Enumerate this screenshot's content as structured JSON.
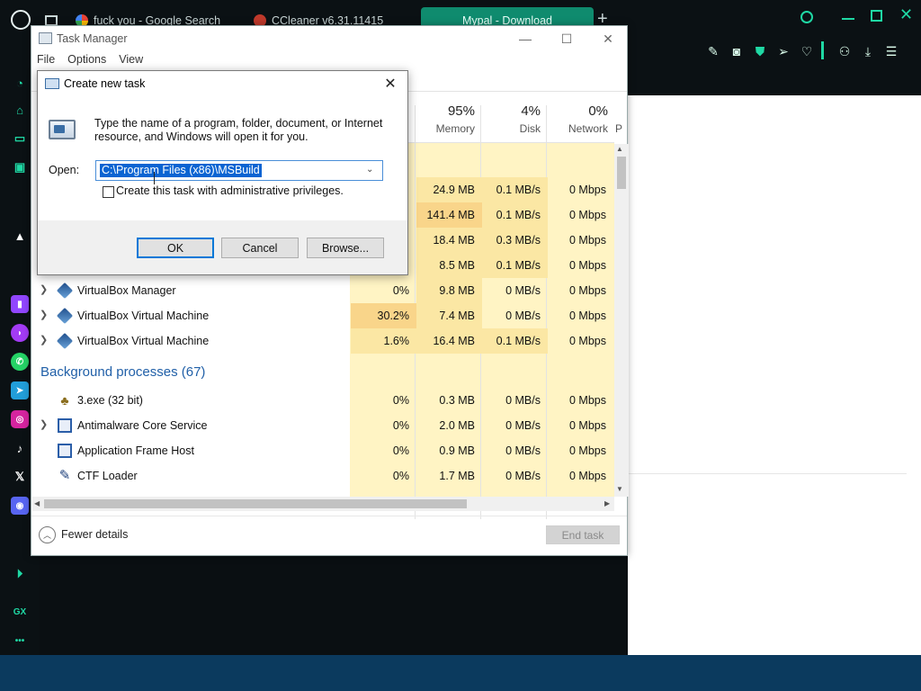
{
  "browser": {
    "tabs": [
      {
        "label": "",
        "icon": "display-icon"
      },
      {
        "label": "fuck you - Google Search",
        "icon": "google-icon"
      },
      {
        "label": "CCleaner v6.31.11415",
        "icon": "ccleaner-icon"
      },
      {
        "label": "Mypal - Download",
        "icon": "document-icon"
      }
    ],
    "new_tab": "+",
    "sidebar_labels": {
      "gx": "GX",
      "more": "•••"
    }
  },
  "task_manager": {
    "title": "Task Manager",
    "menu": [
      "File",
      "Options",
      "View"
    ],
    "columns": {
      "memory": {
        "pct": "95%",
        "label": "Memory"
      },
      "disk": {
        "pct": "4%",
        "label": "Disk"
      },
      "network": {
        "pct": "0%",
        "label": "Network"
      },
      "power": {
        "label": "P"
      }
    },
    "hidden_rows": [
      {
        "memory": "24.9 MB",
        "disk": "0.1 MB/s",
        "network": "0 Mbps"
      },
      {
        "memory": "141.4 MB",
        "disk": "0.1 MB/s",
        "network": "0 Mbps"
      },
      {
        "memory": "18.4 MB",
        "disk": "0.3 MB/s",
        "network": "0 Mbps"
      },
      {
        "memory": "8.5 MB",
        "disk": "0.1 MB/s",
        "network": "0 Mbps"
      }
    ],
    "apps": [
      {
        "name": "VirtualBox Manager",
        "cpu": "0%",
        "memory": "9.8 MB",
        "disk": "0 MB/s",
        "network": "0 Mbps"
      },
      {
        "name": "VirtualBox Virtual Machine",
        "cpu": "30.2%",
        "memory": "7.4 MB",
        "disk": "0 MB/s",
        "network": "0 Mbps"
      },
      {
        "name": "VirtualBox Virtual Machine",
        "cpu": "1.6%",
        "memory": "16.4 MB",
        "disk": "0.1 MB/s",
        "network": "0 Mbps"
      }
    ],
    "background_title": "Background processes (67)",
    "background": [
      {
        "name": "3.exe (32 bit)",
        "cpu": "0%",
        "memory": "0.3 MB",
        "disk": "0 MB/s",
        "network": "0 Mbps"
      },
      {
        "name": "Antimalware Core Service",
        "cpu": "0%",
        "memory": "2.0 MB",
        "disk": "0 MB/s",
        "network": "0 Mbps"
      },
      {
        "name": "Application Frame Host",
        "cpu": "0%",
        "memory": "0.9 MB",
        "disk": "0 MB/s",
        "network": "0 Mbps"
      },
      {
        "name": "CTF Loader",
        "cpu": "0%",
        "memory": "1.7 MB",
        "disk": "0 MB/s",
        "network": "0 Mbps"
      }
    ],
    "fewer_details": "Fewer details",
    "end_task": "End task"
  },
  "run_dialog": {
    "title": "Create new task",
    "description": "Type the name of a program, folder, document, or Internet resource, and Windows will open it for you.",
    "open_label": "Open:",
    "open_value": "C:\\Program Files (x86)\\MSBuild",
    "admin_checkbox_label": "Create this task with administrative privileges.",
    "admin_checked": false,
    "ok": "OK",
    "cancel": "Cancel",
    "browse": "Browse..."
  },
  "colors": {
    "accent": "#1fd8a4",
    "active_tab": "#0f8b6e",
    "selection": "#0a64d2",
    "group_title": "#2160a8",
    "heat_low": "#fff4c4",
    "heat_mid": "#fbe7a4",
    "heat_high": "#f9d58a"
  }
}
